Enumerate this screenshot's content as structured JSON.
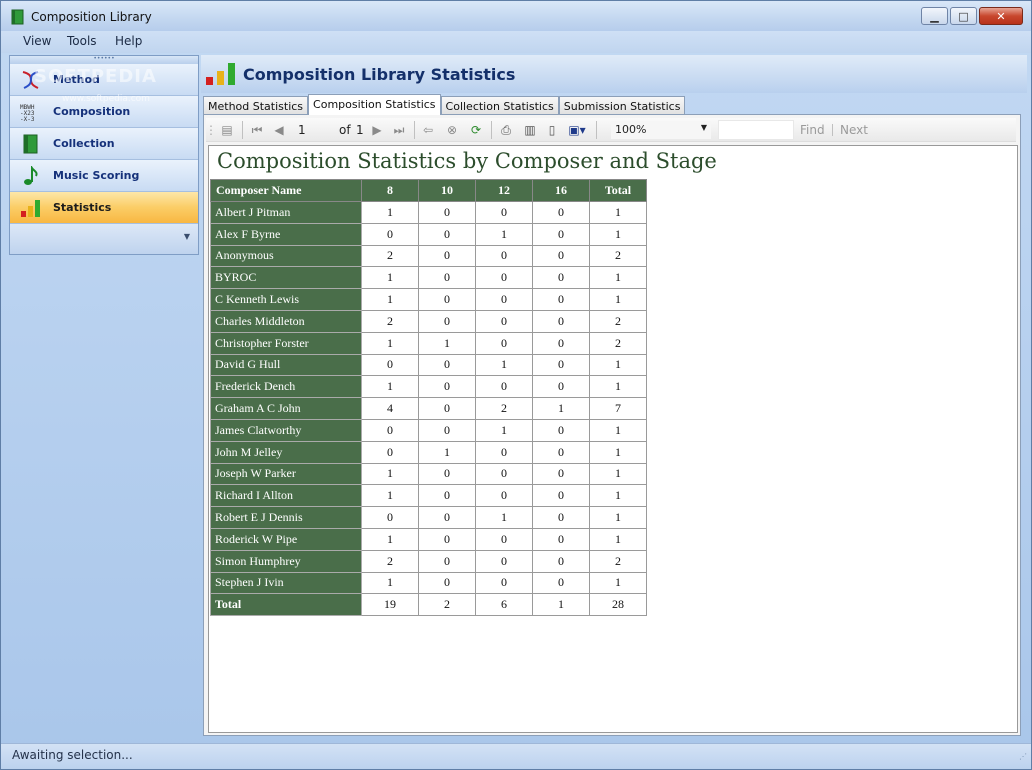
{
  "window": {
    "title": "Composition Library"
  },
  "menu": [
    "View",
    "Tools",
    "Help"
  ],
  "sidebar": {
    "items": [
      {
        "label": "Method",
        "icon": "method-icon",
        "active": false
      },
      {
        "label": "Composition",
        "icon": "composition-icon",
        "active": false
      },
      {
        "label": "Collection",
        "icon": "book-icon",
        "active": false
      },
      {
        "label": "Music Scoring",
        "icon": "music-note-icon",
        "active": false
      },
      {
        "label": "Statistics",
        "icon": "bar-chart-icon",
        "active": true
      }
    ],
    "watermark": "SOFTPEDIA",
    "watermark_url": "www.softpedia.com"
  },
  "header": {
    "title": "Composition Library Statistics"
  },
  "tabs": [
    "Method Statistics",
    "Composition Statistics",
    "Collection Statistics",
    "Submission Statistics"
  ],
  "active_tab": "Composition Statistics",
  "toolbar": {
    "page": "1",
    "of_label": "of",
    "total_pages": "1",
    "zoom": "100%",
    "find_label": "Find",
    "next_label": "Next"
  },
  "report": {
    "title": "Composition Statistics by Composer and Stage",
    "columns": [
      "Composer Name",
      "8",
      "10",
      "12",
      "16",
      "Total"
    ],
    "rows": [
      [
        "Albert J Pitman",
        "1",
        "0",
        "0",
        "0",
        "1"
      ],
      [
        "Alex F Byrne",
        "0",
        "0",
        "1",
        "0",
        "1"
      ],
      [
        "Anonymous",
        "2",
        "0",
        "0",
        "0",
        "2"
      ],
      [
        "BYROC",
        "1",
        "0",
        "0",
        "0",
        "1"
      ],
      [
        "C Kenneth Lewis",
        "1",
        "0",
        "0",
        "0",
        "1"
      ],
      [
        "Charles Middleton",
        "2",
        "0",
        "0",
        "0",
        "2"
      ],
      [
        "Christopher Forster",
        "1",
        "1",
        "0",
        "0",
        "2"
      ],
      [
        "David G Hull",
        "0",
        "0",
        "1",
        "0",
        "1"
      ],
      [
        "Frederick Dench",
        "1",
        "0",
        "0",
        "0",
        "1"
      ],
      [
        "Graham A C John",
        "4",
        "0",
        "2",
        "1",
        "7"
      ],
      [
        "James Clatworthy",
        "0",
        "0",
        "1",
        "0",
        "1"
      ],
      [
        "John M Jelley",
        "0",
        "1",
        "0",
        "0",
        "1"
      ],
      [
        "Joseph W Parker",
        "1",
        "0",
        "0",
        "0",
        "1"
      ],
      [
        "Richard I Allton",
        "1",
        "0",
        "0",
        "0",
        "1"
      ],
      [
        "Robert E J Dennis",
        "0",
        "0",
        "1",
        "0",
        "1"
      ],
      [
        "Roderick W Pipe",
        "1",
        "0",
        "0",
        "0",
        "1"
      ],
      [
        "Simon Humphrey",
        "2",
        "0",
        "0",
        "0",
        "2"
      ],
      [
        "Stephen J Ivin",
        "1",
        "0",
        "0",
        "0",
        "1"
      ]
    ],
    "total_row": [
      "Total",
      "19",
      "2",
      "6",
      "1",
      "28"
    ]
  },
  "status": {
    "text": "Awaiting selection..."
  },
  "colors": {
    "table_header": "#4a6e4a",
    "title_color": "#2c4d2c",
    "active_nav": "#fbcd66"
  }
}
